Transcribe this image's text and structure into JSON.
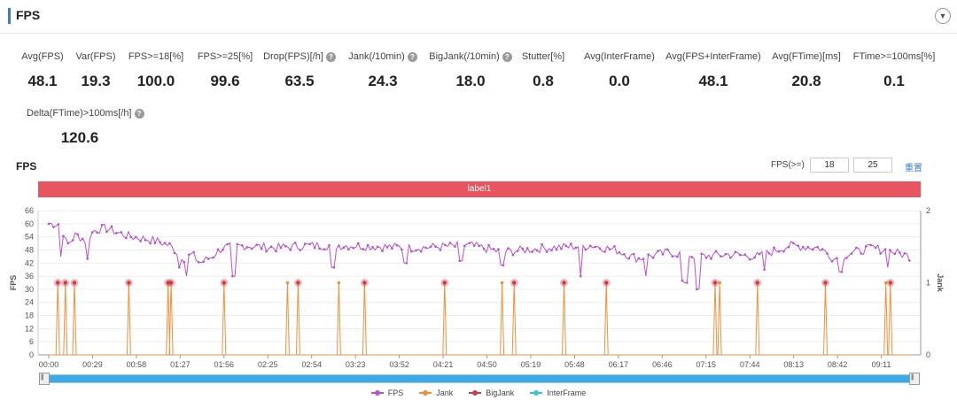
{
  "header": {
    "title": "FPS",
    "toggle_icon": "chevron-down-icon"
  },
  "metrics": [
    {
      "label": "Avg(FPS)",
      "value": "48.1",
      "help": false
    },
    {
      "label": "Var(FPS)",
      "value": "19.3",
      "help": false
    },
    {
      "label": "FPS>=18[%]",
      "value": "100.0",
      "help": false
    },
    {
      "label": "FPS>=25[%]",
      "value": "99.6",
      "help": false
    },
    {
      "label": "Drop(FPS)[/h]",
      "value": "63.5",
      "help": true
    },
    {
      "label": "Jank(/10min)",
      "value": "24.3",
      "help": true
    },
    {
      "label": "BigJank(/10min)",
      "value": "18.0",
      "help": true
    },
    {
      "label": "Stutter[%]",
      "value": "0.8",
      "help": false
    },
    {
      "label": "Avg(InterFrame)",
      "value": "0.0",
      "help": false
    },
    {
      "label": "Avg(FPS+InterFrame)",
      "value": "48.1",
      "help": false
    },
    {
      "label": "Avg(FTime)[ms]",
      "value": "20.8",
      "help": false
    },
    {
      "label": "FTime>=100ms[%]",
      "value": "0.1",
      "help": false
    },
    {
      "label": "Delta(FTime)>100ms[/h]",
      "value": "120.6",
      "help": true
    }
  ],
  "chart": {
    "title": "FPS",
    "threshold_label": "FPS(>=)",
    "threshold_low": "18",
    "threshold_high": "25",
    "reset_label": "重置",
    "label_bar": "label1"
  },
  "chart_data": {
    "type": "line",
    "ylabel_left": "FPS",
    "ylabel_right": "Jank",
    "y_left_ticks": [
      0,
      6,
      12,
      18,
      24,
      30,
      36,
      42,
      48,
      54,
      60,
      66
    ],
    "y_right_ticks": [
      0,
      1,
      2
    ],
    "x_ticks": [
      "00:00",
      "00:29",
      "00:58",
      "01:27",
      "01:56",
      "02:25",
      "02:54",
      "03:23",
      "03:52",
      "04:21",
      "04:50",
      "05:19",
      "05:48",
      "06:17",
      "06:46",
      "07:15",
      "07:44",
      "08:13",
      "08:42",
      "09:11"
    ],
    "x_range_seconds": [
      0,
      570
    ],
    "fps_anchors": [
      [
        0,
        60
      ],
      [
        8,
        60
      ],
      [
        12,
        50
      ],
      [
        18,
        55
      ],
      [
        25,
        52
      ],
      [
        30,
        57
      ],
      [
        38,
        58
      ],
      [
        45,
        56
      ],
      [
        55,
        54
      ],
      [
        65,
        53
      ],
      [
        72,
        52
      ],
      [
        80,
        50
      ],
      [
        90,
        44
      ],
      [
        95,
        46
      ],
      [
        100,
        42
      ],
      [
        108,
        45
      ],
      [
        115,
        49
      ],
      [
        130,
        50
      ],
      [
        150,
        49
      ],
      [
        170,
        50
      ],
      [
        200,
        50
      ],
      [
        240,
        49
      ],
      [
        280,
        50
      ],
      [
        300,
        47
      ],
      [
        330,
        49
      ],
      [
        360,
        50
      ],
      [
        375,
        48
      ],
      [
        390,
        44
      ],
      [
        410,
        47
      ],
      [
        430,
        45
      ],
      [
        450,
        46
      ],
      [
        470,
        45
      ],
      [
        490,
        50
      ],
      [
        510,
        49
      ],
      [
        520,
        44
      ],
      [
        528,
        46
      ],
      [
        545,
        49
      ],
      [
        560,
        47
      ],
      [
        570,
        45
      ]
    ],
    "fps_dips": [
      [
        8,
        45
      ],
      [
        26,
        44
      ],
      [
        86,
        40
      ],
      [
        91,
        36
      ],
      [
        122,
        36
      ],
      [
        188,
        40
      ],
      [
        236,
        42
      ],
      [
        273,
        43
      ],
      [
        300,
        41
      ],
      [
        352,
        36
      ],
      [
        395,
        36
      ],
      [
        420,
        34
      ],
      [
        422,
        33
      ],
      [
        430,
        30
      ],
      [
        474,
        39
      ],
      [
        524,
        38
      ],
      [
        555,
        40
      ]
    ],
    "jank_events": [
      6,
      11,
      17,
      53,
      79,
      81,
      116,
      158,
      165,
      192,
      209,
      262,
      300,
      308,
      341,
      369,
      441,
      444,
      469,
      514,
      554,
      557
    ],
    "bigjank_events": [
      6,
      11,
      17,
      53,
      79,
      81,
      116,
      165,
      209,
      262,
      308,
      341,
      369,
      441,
      469,
      514,
      557
    ],
    "series": [
      {
        "name": "FPS",
        "color": "#b94fd4"
      },
      {
        "name": "Jank",
        "color": "#f2913a"
      },
      {
        "name": "BigJank",
        "color": "#cf3a48"
      },
      {
        "name": "InterFrame",
        "color": "#35c6d2"
      }
    ],
    "ylim_left": [
      0,
      66
    ],
    "ylim_right": [
      0,
      2
    ]
  }
}
